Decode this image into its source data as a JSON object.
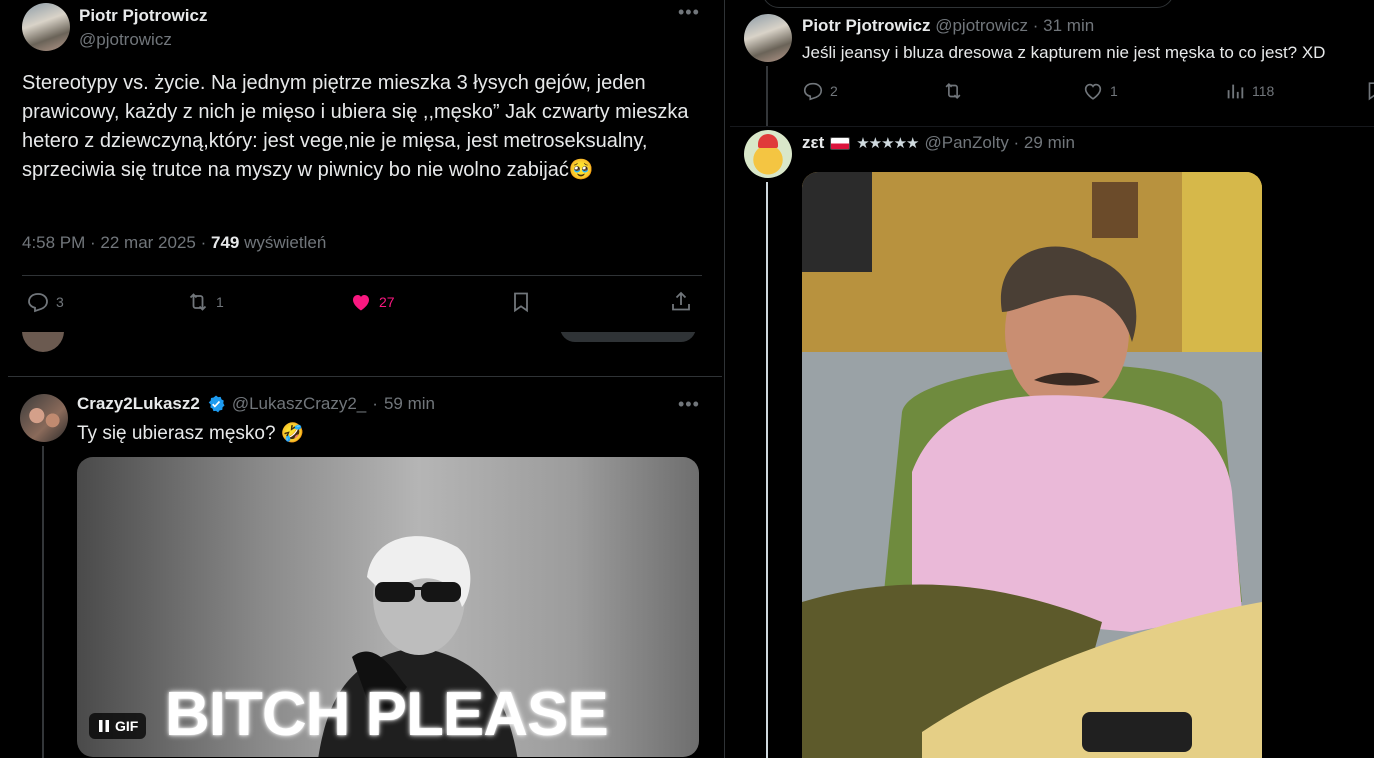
{
  "main_tweet": {
    "author_name": "Piotr Pjotrowicz",
    "author_handle": "@pjotrowicz",
    "more_icon": "•••",
    "text": "Stereotypy vs. życie. Na jednym piętrze mieszka 3 łysych gejów, jeden prawicowy, każdy z nich je mięso i ubiera się ,,męsko” Jak czwarty mieszka hetero z dziewczyną,który: jest vege,nie je mięsa, jest metroseksualny, sprzeciwia się trutce na myszy w piwnicy bo nie wolno zabijać🥹",
    "time": "4:58 PM · 22 mar 2025 · ",
    "views_count": "749",
    "views_label": " wyświetleń",
    "actions": {
      "replies": "3",
      "reposts": "1",
      "likes": "27"
    }
  },
  "reply_gif": {
    "author_name": "Crazy2Lukasz2",
    "author_handle": "@LukaszCrazy2_",
    "sep": "·",
    "time": "59 min",
    "more_icon": "•••",
    "text": "Ty się ubierasz męsko? 🤣",
    "gif_caption": "BITCH PLEASE",
    "gif_badge": "GIF"
  },
  "right_thread": {
    "first": {
      "author_name": "Piotr Pjotrowicz",
      "author_handle": "@pjotrowicz · 31 min",
      "text": "Jeśli jeansy i bluza dresowa z kapturem nie jest męska to co jest? XD",
      "actions": {
        "replies": "2",
        "likes": "1",
        "views": "118"
      }
    },
    "second": {
      "author_name": "zεt",
      "stars": "★★★★★",
      "author_handle": "@PanZolty · 29 min"
    }
  },
  "colors": {
    "background": "#000000",
    "text": "#e7e9ea",
    "muted": "#71767b",
    "like_pink": "#f91880",
    "verified_blue": "#1d9bf0",
    "divider": "#2f3336"
  },
  "icons": [
    "more-icon",
    "reply-icon",
    "repost-icon",
    "heart-icon",
    "bookmark-icon",
    "share-icon",
    "verified-icon",
    "pause-icon",
    "views-icon"
  ]
}
